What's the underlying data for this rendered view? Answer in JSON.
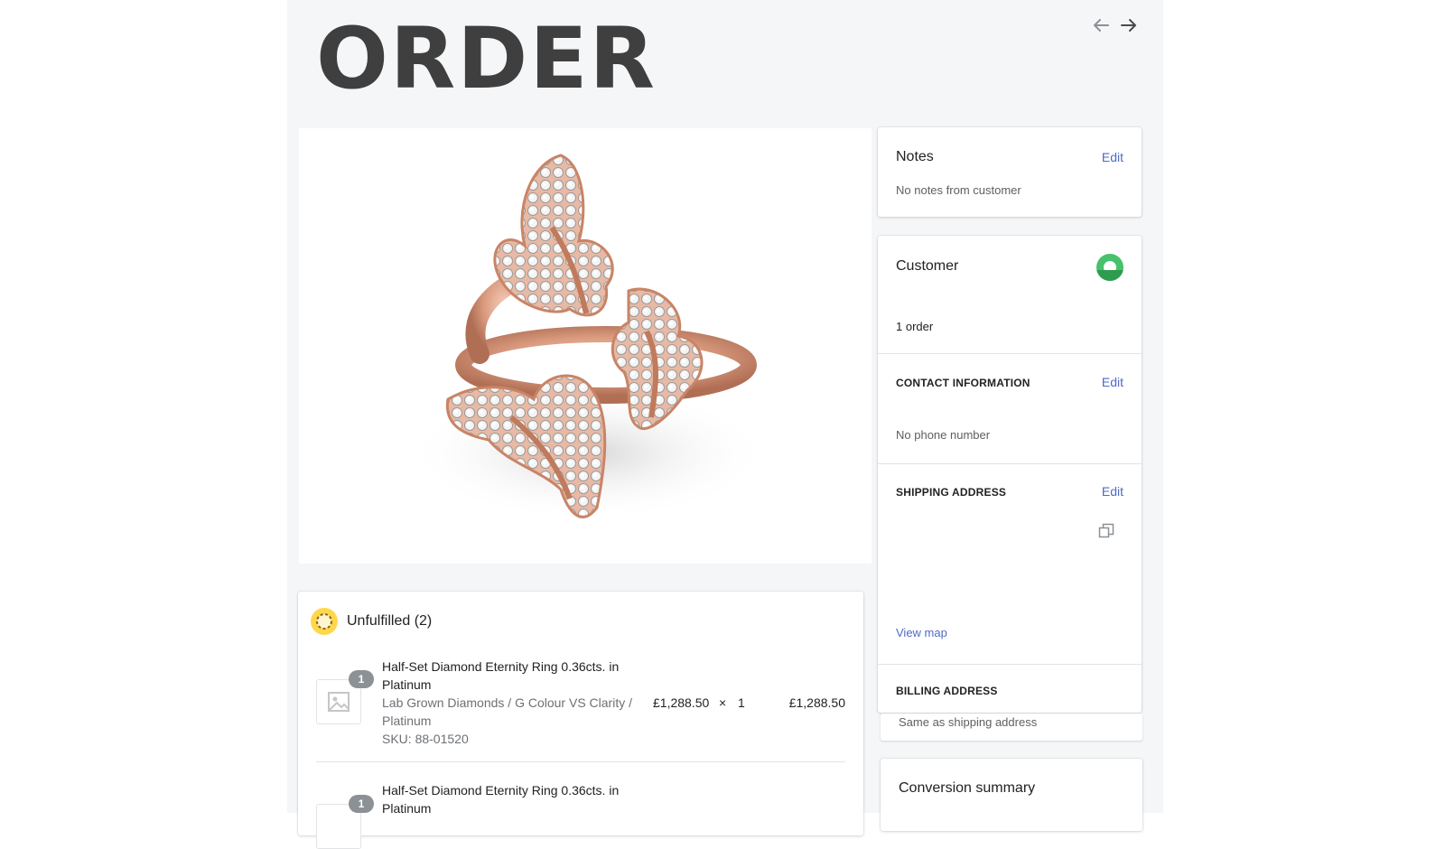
{
  "header": {
    "title": "ORDER",
    "back_icon": "arrow-left-icon",
    "forward_icon": "arrow-right-icon"
  },
  "product_image": {
    "description_icon": "butterfly-ring-image"
  },
  "notes": {
    "title": "Notes",
    "edit_label": "Edit",
    "text": "No notes from customer"
  },
  "customer": {
    "title": "Customer",
    "orders": "1 order",
    "avatar_color": "#47c16b",
    "contact": {
      "heading": "CONTACT INFORMATION",
      "edit_label": "Edit",
      "phone": "No phone number"
    },
    "shipping": {
      "heading": "SHIPPING ADDRESS",
      "edit_label": "Edit",
      "copy_icon": "copy-icon",
      "view_map": "View map"
    },
    "billing": {
      "heading": "BILLING ADDRESS",
      "text": "Same as shipping address"
    }
  },
  "conversion": {
    "title": "Conversion summary"
  },
  "fulfillment": {
    "status_label": "Unfulfilled (2)",
    "status_color": "#ffd74a",
    "items": [
      {
        "qty_badge": "1",
        "name_line1": "Half-Set Diamond Eternity Ring 0.36cts. in",
        "name_line2": "Platinum",
        "variant_line1": "Lab Grown Diamonds / G Colour VS Clarity /",
        "variant_line2": "Platinum",
        "sku": "SKU: 88-01520",
        "price": "£1,288.50",
        "times": "×",
        "quantity": "1",
        "total": "£1,288.50"
      },
      {
        "qty_badge": "1",
        "name_line1": "Half-Set Diamond Eternity Ring 0.36cts. in",
        "name_line2": "Platinum"
      }
    ]
  },
  "colors": {
    "link": "#4f6bc4",
    "title_text": "#3f3f3f"
  }
}
